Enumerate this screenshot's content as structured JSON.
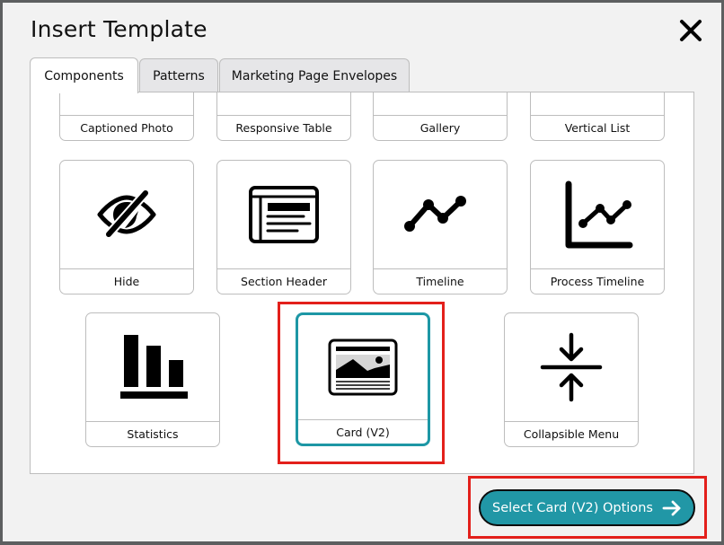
{
  "dialog": {
    "title": "Insert Template",
    "close_icon": "close-icon"
  },
  "tabs": [
    {
      "label": "Components",
      "active": true
    },
    {
      "label": "Patterns",
      "active": false
    },
    {
      "label": "Marketing Page Envelopes",
      "active": false
    }
  ],
  "templates": {
    "row0": [
      {
        "label": "Captioned Photo"
      },
      {
        "label": "Responsive Table"
      },
      {
        "label": "Gallery"
      },
      {
        "label": "Vertical List"
      }
    ],
    "row1": [
      {
        "label": "Hide",
        "icon": "eye-slash-icon"
      },
      {
        "label": "Section Header",
        "icon": "section-header-icon"
      },
      {
        "label": "Timeline",
        "icon": "timeline-icon"
      },
      {
        "label": "Process Timeline",
        "icon": "line-chart-icon"
      }
    ],
    "row2": [
      {
        "label": "Statistics",
        "icon": "bar-chart-icon"
      },
      {
        "label": "Card (V2)",
        "icon": "card-icon",
        "selected": true
      },
      {
        "label": "Collapsible Menu",
        "icon": "collapse-icon"
      }
    ]
  },
  "colors": {
    "accent": "#2197a6",
    "selected_border": "#1d97a5",
    "highlight": "#e3201b"
  },
  "action_button": {
    "label": "Select Card (V2) Options",
    "icon": "arrow-right-icon"
  }
}
